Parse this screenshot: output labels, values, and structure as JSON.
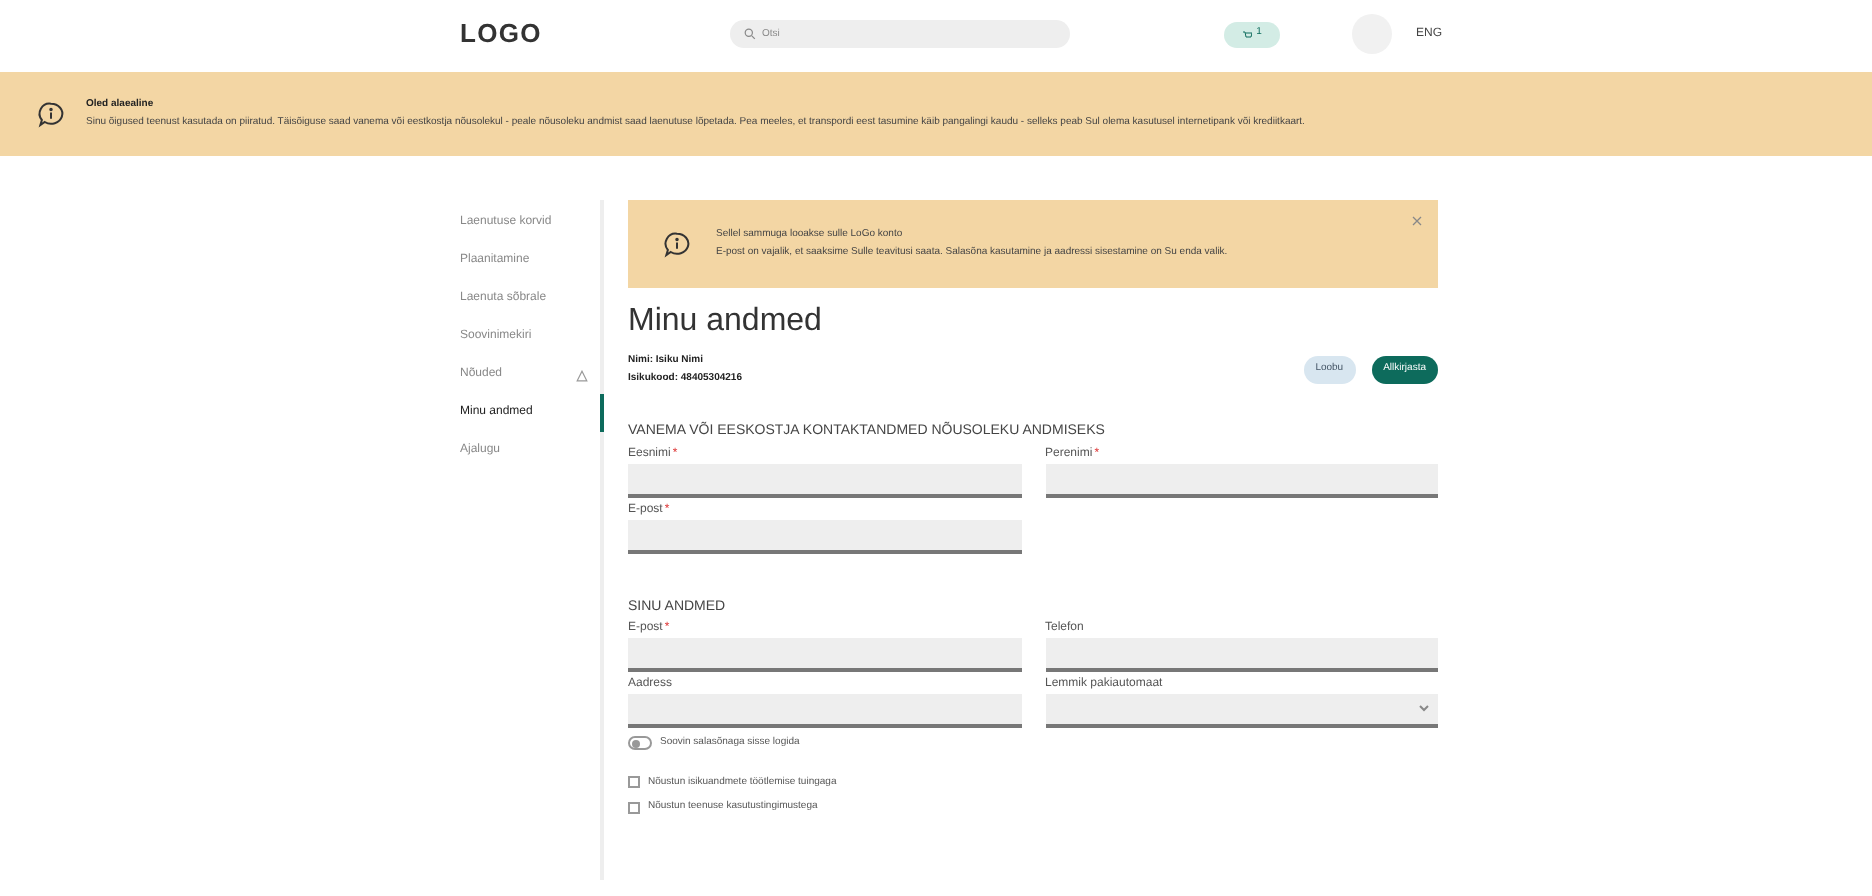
{
  "header": {
    "logo": "LOGO",
    "search": {
      "placeholder": "Otsi"
    },
    "cart_count": "1",
    "language": "ENG"
  },
  "banner": {
    "title": "Oled alaealine",
    "text": "Sinu õigused teenust kasutada on piiratud. Täisõiguse saad vanema või eestkostja nõusolekul - peale nõusoleku andmist saad laenutuse lõpetada. Pea meeles, et transpordi eest tasumine käib pangalingi kaudu - selleks peab Sul olema kasutusel internetipank või krediitkaart."
  },
  "sidebar": {
    "items": [
      {
        "label": "Laenutuse korvid",
        "selected": false,
        "alert": false
      },
      {
        "label": "Plaanitamine",
        "selected": false,
        "alert": false
      },
      {
        "label": "Laenuta sõbrale",
        "selected": false,
        "alert": false
      },
      {
        "label": "Soovinimekiri",
        "selected": false,
        "alert": false
      },
      {
        "label": "Nõuded",
        "selected": false,
        "alert": true
      },
      {
        "label": "Minu andmed",
        "selected": true,
        "alert": false
      },
      {
        "label": "Ajalugu",
        "selected": false,
        "alert": false
      }
    ]
  },
  "notice": {
    "lines": [
      "Sellel sammuga looakse sulle LoGo konto",
      "E-post on vajalik, et saaksime Sulle teavitusi saata. Salasõna kasutamine ja aadressi sisestamine on Su enda valik."
    ]
  },
  "page_title": "Minu andmed",
  "user": {
    "name": "Nimi: Isiku Nimi",
    "id_code": "Isikukood: 48405304216"
  },
  "buttons": [
    {
      "label": "Loobu",
      "kind": "secondary"
    },
    {
      "label": "Allkirjasta",
      "kind": "primary"
    }
  ],
  "sections": [
    {
      "heading": "VANEMA VÕI EESKOSTJA KONTAKTANDMED NÕUSOLEKU ANDMISEKS",
      "fields": [
        {
          "label": "Eesnimi",
          "mark": "*",
          "kind": "text"
        },
        {
          "label": "Perenimi",
          "mark": "*",
          "kind": "text"
        },
        {
          "label": "E-post",
          "mark": "*",
          "kind": "text"
        }
      ]
    },
    {
      "heading": "SINU ANDMED",
      "fields": [
        {
          "label": "E-post",
          "mark": "*",
          "kind": "text"
        },
        {
          "label": "Telefon",
          "kind": "text"
        },
        {
          "label": "Aadress",
          "kind": "text"
        },
        {
          "label": "Lemmik pakiautomaat",
          "kind": "select"
        }
      ]
    }
  ],
  "toggle": {
    "label": "Soovin salasõnaga sisse logida",
    "on": false
  },
  "checkboxes": [
    {
      "label": "Nõustun isikuandmete töötlemise tuingaga",
      "checked": false
    },
    {
      "label": "Nõustun teenuse kasutustingimustega",
      "checked": false
    }
  ]
}
